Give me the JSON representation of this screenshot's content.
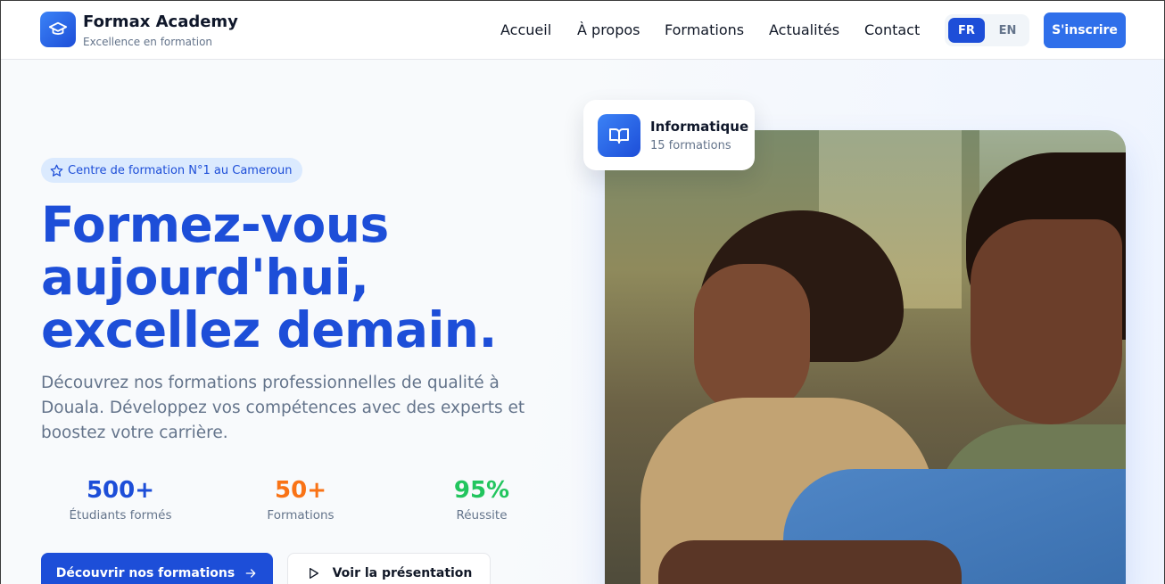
{
  "header": {
    "brand_name": "Formax Academy",
    "brand_tagline": "Excellence en formation",
    "logo_icon": "graduation-cap-icon",
    "nav": [
      {
        "label": "Accueil"
      },
      {
        "label": "À propos"
      },
      {
        "label": "Formations"
      },
      {
        "label": "Actualités"
      },
      {
        "label": "Contact"
      }
    ],
    "languages": {
      "active": "FR",
      "other": "EN"
    },
    "signup_label": "S'inscrire"
  },
  "hero": {
    "badge": "Centre de formation N°1 au Cameroun",
    "badge_icon": "star-icon",
    "title_lines": [
      "Formez-vous",
      "aujourd'hui,",
      "excellez demain."
    ],
    "description": "Découvrez nos formations professionnelles de qualité à Douala. Développez vos compétences avec des experts et boostez votre carrière.",
    "stats": [
      {
        "value": "500+",
        "label": "Étudiants formés",
        "color": "#1d4ed8"
      },
      {
        "value": "50+",
        "label": "Formations",
        "color": "#f97316"
      },
      {
        "value": "95%",
        "label": "Réussite",
        "color": "#22c55e"
      }
    ],
    "primary_button": "Découvrir nos formations",
    "secondary_button": "Voir la présentation"
  },
  "feature_card": {
    "title": "Informatique",
    "subtitle": "15 formations",
    "icon": "book-open-icon"
  },
  "colors": {
    "primary": "#1d4ed8",
    "accent_orange": "#f97316",
    "accent_green": "#22c55e"
  }
}
